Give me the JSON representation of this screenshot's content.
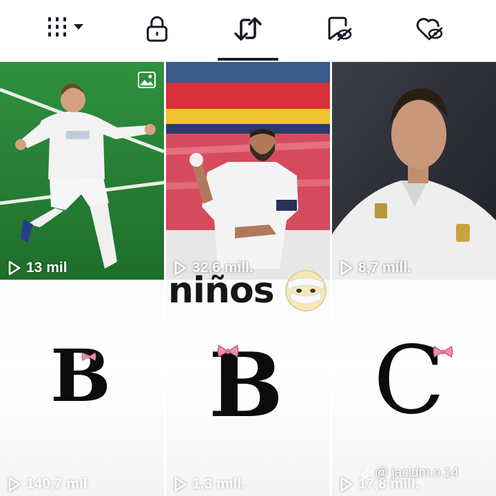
{
  "tabs": [
    {
      "name": "videos",
      "icon": "grid-icon"
    },
    {
      "name": "private",
      "icon": "lock-icon"
    },
    {
      "name": "reposts",
      "icon": "repost-icon",
      "selected": true
    },
    {
      "name": "favorites",
      "icon": "bookmark-icon"
    },
    {
      "name": "liked",
      "icon": "heart-icon"
    }
  ],
  "grid": {
    "top_row": [
      {
        "subject": "player celebrating",
        "views": "13 mil",
        "has_photo_badge": true
      },
      {
        "subject": "player fist pump",
        "views": "32,6 mill."
      },
      {
        "subject": "player portrait",
        "views": "8,7 mill."
      }
    ],
    "bottom_row": [
      {
        "letter": "B",
        "views": "140,7 mil"
      },
      {
        "letter": "B",
        "views": "1,3 mill."
      },
      {
        "letter": "C",
        "views": "17,8 mill."
      }
    ]
  },
  "overlay": {
    "text": "niños",
    "emoji": "face-with-bandage-icon"
  },
  "watermark": {
    "text": "@ jacidm.o.14",
    "icon": "tiktok-logo-icon"
  },
  "colors": {
    "kit_white": "#f2f2f2",
    "pitch_green": "#2e8a3a",
    "text_dark": "#161823",
    "bow_pink": "#e88fb4"
  }
}
